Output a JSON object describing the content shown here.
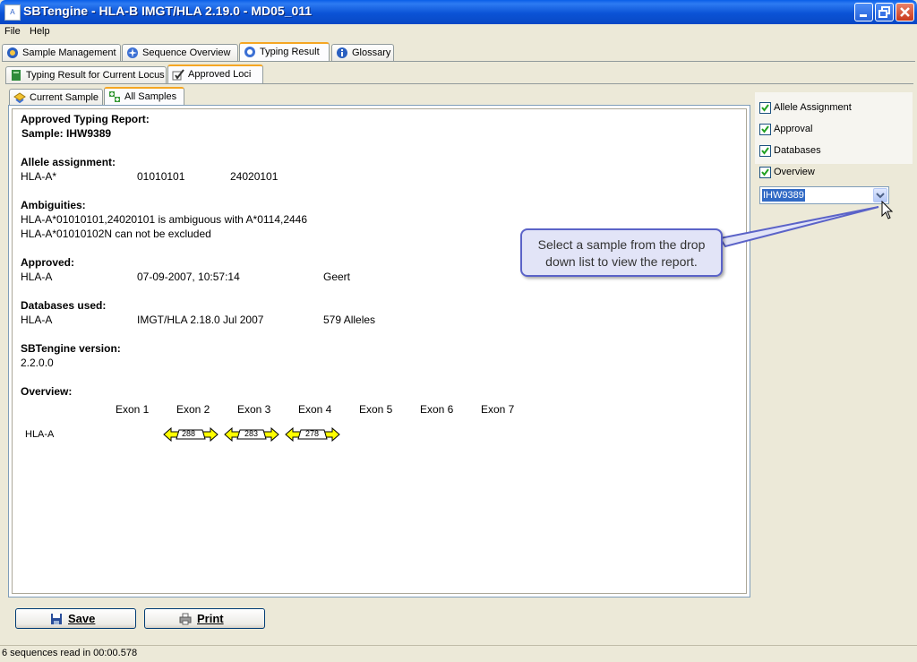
{
  "window": {
    "title": "SBTengine - HLA-B IMGT/HLA 2.19.0 - MD05_011",
    "app_icon": "A"
  },
  "menu": [
    "File",
    "Help"
  ],
  "main_tabs": [
    "Sample Management",
    "Sequence Overview",
    "Typing Result",
    "Glossary"
  ],
  "sub_tabs": [
    "Typing Result for Current Locus",
    "Approved Loci"
  ],
  "sample_tabs": [
    "Current Sample",
    "All Samples"
  ],
  "report": {
    "title": "Approved Typing Report:",
    "sample": "Sample: IHW9389",
    "allele_heading": "Allele assignment:",
    "allele_locus": "HLA-A*",
    "allele_1": "01010101",
    "allele_2": "24020101",
    "ambiguities_heading": "Ambiguities:",
    "ambiguity_1": "HLA-A*01010101,24020101 is ambiguous with A*0114,2446",
    "ambiguity_2": "HLA-A*01010102N can not be excluded",
    "approved_heading": "Approved:",
    "approved_locus": "HLA-A",
    "approved_date": "07-09-2007, 10:57:14",
    "approved_by": "Geert",
    "databases_heading": "Databases used:",
    "db_locus": "HLA-A",
    "db_name": "IMGT/HLA 2.18.0 Jul 2007",
    "db_alleles": "579 Alleles",
    "version_heading": "SBTengine version:",
    "version": "2.2.0.0",
    "overview_heading": "Overview:",
    "exons": [
      "Exon 1",
      "Exon 2",
      "Exon 3",
      "Exon 4",
      "Exon 5",
      "Exon 6",
      "Exon 7"
    ],
    "overview_locus": "HLA-A",
    "exon_reads": [
      "288",
      "283",
      "278"
    ]
  },
  "options": [
    "Allele Assignment",
    "Approval",
    "Databases",
    "Overview"
  ],
  "sample_select": {
    "value": "IHW9389"
  },
  "callout": {
    "line1": "Select a sample from the drop",
    "line2": "down list to view the report."
  },
  "buttons": {
    "save": "Save",
    "print": "Print"
  },
  "status": "6 sequences read in 00:00.578",
  "colors": {
    "title_bar": "#0A5FE8",
    "active_tab_accent": "#F5A623",
    "exon_arrow": "#FFFF00",
    "callout_border": "#5B63C8"
  }
}
